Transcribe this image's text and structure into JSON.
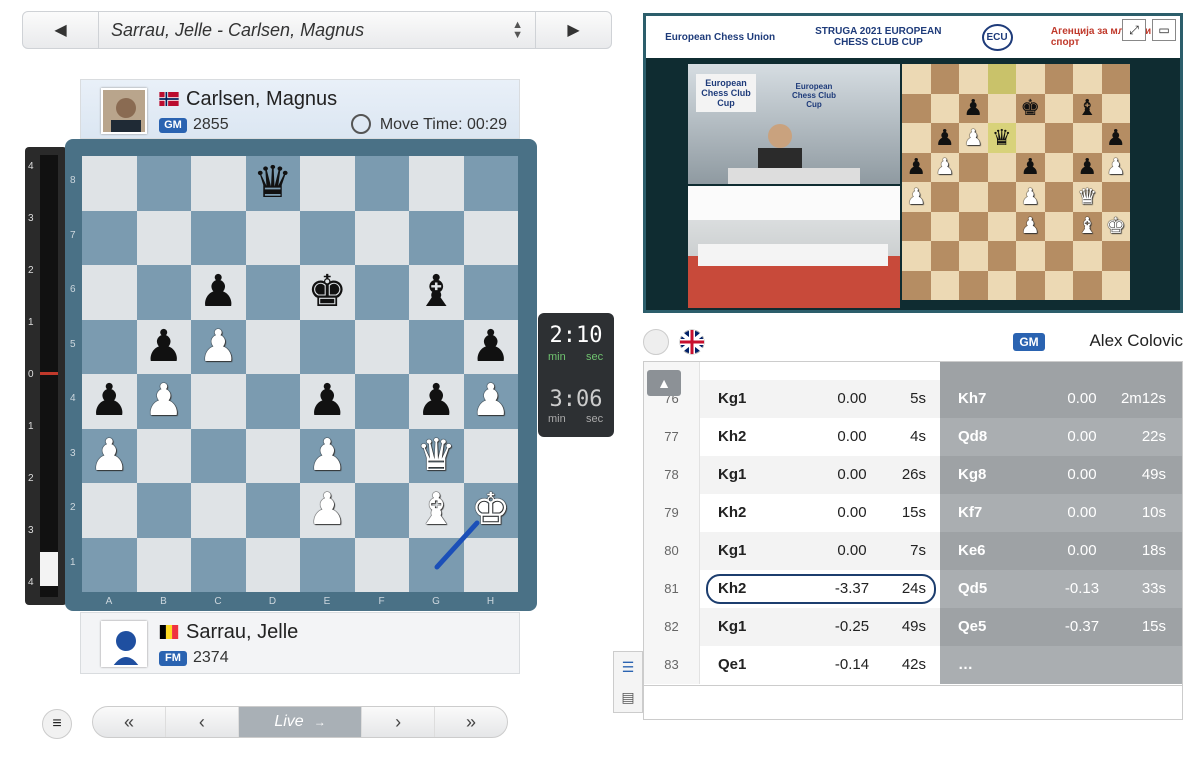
{
  "game_selector": {
    "prev_icon": "triangle-left-icon",
    "title": "Sarrau, Jelle - Carlsen, Magnus",
    "next_icon": "triangle-right-icon"
  },
  "top_player": {
    "name": "Carlsen, Magnus",
    "country": "Norway",
    "title": "GM",
    "rating": "2855",
    "move_time": "Move Time: 00:29"
  },
  "bottom_player": {
    "name": "Sarrau, Jelle",
    "country": "Belgium",
    "title": "FM",
    "rating": "2374"
  },
  "eval_bar": {
    "ticks_top": [
      "4",
      "3",
      "2",
      "1",
      "0",
      "1",
      "2",
      "3",
      "4"
    ]
  },
  "board": {
    "ranks": [
      "8",
      "7",
      "6",
      "5",
      "4",
      "3",
      "2",
      "1"
    ],
    "files": [
      "A",
      "B",
      "C",
      "D",
      "E",
      "F",
      "G",
      "H"
    ],
    "position": [
      [
        "",
        "",
        "",
        "bq",
        "",
        "",
        "",
        ""
      ],
      [
        "",
        "",
        "",
        "",
        "",
        "",
        "",
        ""
      ],
      [
        "",
        "",
        "bp",
        "",
        "bk",
        "",
        "bb",
        ""
      ],
      [
        "",
        "bp",
        "wp",
        "",
        "",
        "",
        "",
        "bp"
      ],
      [
        "bp",
        "wp",
        "",
        "",
        "bp",
        "",
        "bp",
        "wp"
      ],
      [
        "wp",
        "",
        "",
        "",
        "wp",
        "",
        "wq",
        ""
      ],
      [
        "",
        "",
        "",
        "",
        "wp",
        "",
        "wb",
        "wk"
      ],
      [
        "",
        "",
        "",
        "",
        "",
        "",
        "",
        ""
      ]
    ],
    "last_move": "Kh2"
  },
  "clock": {
    "top_time": "2:10",
    "bottom_time": "3:06",
    "min_label": "min",
    "sec_label": "sec"
  },
  "nav": {
    "first": "«",
    "prev": "‹",
    "live": "Live",
    "next": "›",
    "last": "»"
  },
  "video": {
    "logos": [
      "European Chess Union",
      "STRUGA 2021 EUROPEAN CHESS CLUB CUP",
      "ECU",
      "Агенција за млади и спорт"
    ],
    "banner_text": "European Chess Club Cup",
    "position": [
      [
        "",
        "",
        "",
        "",
        "",
        "",
        "",
        ""
      ],
      [
        "",
        "",
        "bp",
        "",
        "bk",
        "",
        "bb",
        ""
      ],
      [
        "",
        "bp",
        "wp",
        "bq",
        "",
        "",
        "",
        "bp"
      ],
      [
        "bp",
        "wp",
        "",
        "",
        "bp",
        "",
        "bp",
        "wp"
      ],
      [
        "wp",
        "",
        "",
        "",
        "wp",
        "",
        "wq",
        ""
      ],
      [
        "",
        "",
        "",
        "",
        "wp",
        "",
        "wb",
        "wk"
      ],
      [
        "",
        "",
        "",
        "",
        "",
        "",
        "",
        ""
      ],
      [
        "",
        "",
        "",
        "",
        "",
        "",
        "",
        ""
      ]
    ]
  },
  "commentator": {
    "title": "GM",
    "name": "Alex Colovic"
  },
  "moves": [
    {
      "num": "76",
      "w": "Kg1",
      "we": "0.00",
      "wt": "5s",
      "b": "Kh7",
      "be": "0.00",
      "bt": "2m12s"
    },
    {
      "num": "77",
      "w": "Kh2",
      "we": "0.00",
      "wt": "4s",
      "b": "Qd8",
      "be": "0.00",
      "bt": "22s"
    },
    {
      "num": "78",
      "w": "Kg1",
      "we": "0.00",
      "wt": "26s",
      "b": "Kg8",
      "be": "0.00",
      "bt": "49s"
    },
    {
      "num": "79",
      "w": "Kh2",
      "we": "0.00",
      "wt": "15s",
      "b": "Kf7",
      "be": "0.00",
      "bt": "10s"
    },
    {
      "num": "80",
      "w": "Kg1",
      "we": "0.00",
      "wt": "7s",
      "b": "Ke6",
      "be": "0.00",
      "bt": "18s"
    },
    {
      "num": "81",
      "w": "Kh2",
      "we": "-3.37",
      "wt": "24s",
      "b": "Qd5",
      "be": "-0.13",
      "bt": "33s",
      "highlight": true
    },
    {
      "num": "82",
      "w": "Kg1",
      "we": "-0.25",
      "wt": "49s",
      "b": "Qe5",
      "be": "-0.37",
      "bt": "15s"
    },
    {
      "num": "83",
      "w": "Qe1",
      "we": "-0.14",
      "wt": "42s",
      "b": "…",
      "be": "",
      "bt": ""
    }
  ],
  "colors": {
    "board_dark": "#7b9bb0",
    "board_light": "#dfe3e6",
    "accent": "#2a63b1",
    "highlight_border": "#1c3d6e"
  }
}
